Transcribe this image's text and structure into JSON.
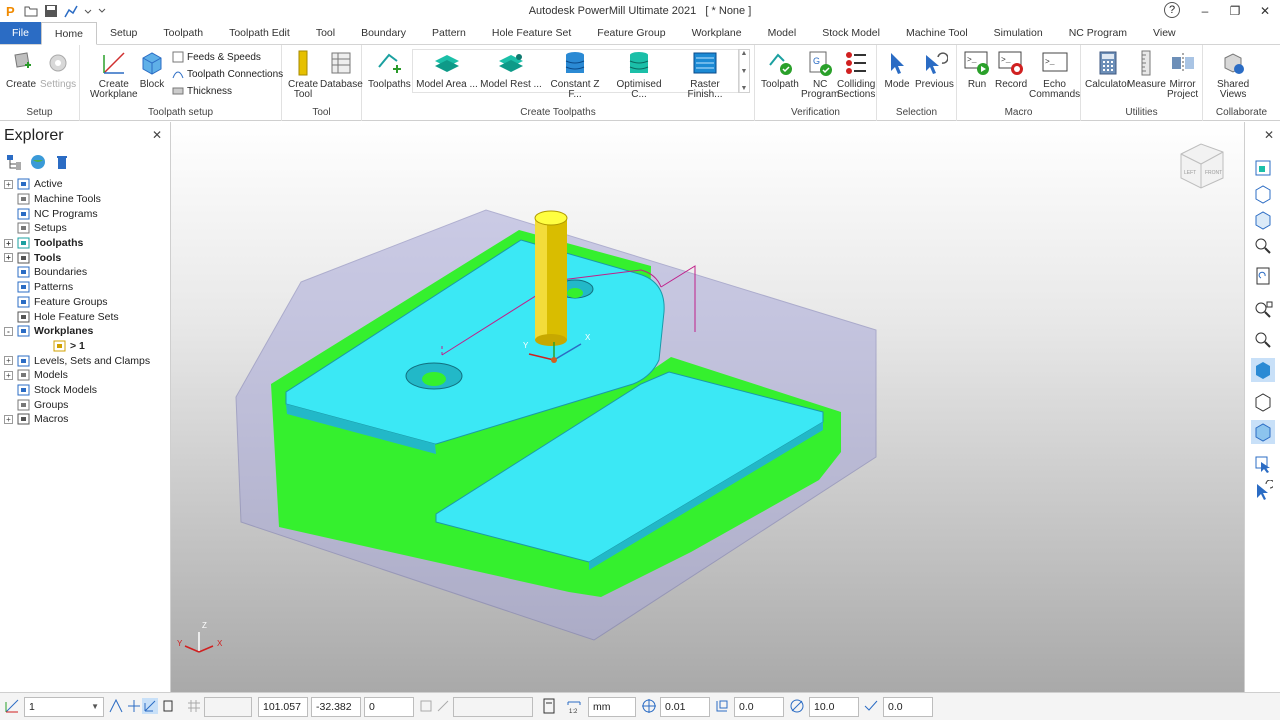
{
  "window": {
    "title": "Autodesk PowerMill Ultimate 2021",
    "document": "[  * None ]",
    "help": "?"
  },
  "tabs": [
    "File",
    "Home",
    "Setup",
    "Toolpath",
    "Toolpath Edit",
    "Tool",
    "Boundary",
    "Pattern",
    "Hole Feature Set",
    "Feature Group",
    "Workplane",
    "Model",
    "Stock Model",
    "Machine Tool",
    "Simulation",
    "NC Program",
    "View"
  ],
  "ribbon": {
    "setup": {
      "label": "Setup",
      "create": "Create",
      "settings": "Settings"
    },
    "toolpath_setup": {
      "label": "Toolpath setup",
      "create_workplane_1": "Create",
      "create_workplane_2": "Workplane",
      "block": "Block",
      "feeds": "Feeds & Speeds",
      "connections": "Toolpath Connections",
      "thickness": "Thickness"
    },
    "tool": {
      "label": "Tool",
      "create_tool_1": "Create",
      "create_tool_2": "Tool",
      "database": "Database"
    },
    "create_toolpaths": {
      "label": "Create Toolpaths",
      "toolpaths": "Toolpaths",
      "items": [
        "Model Area ...",
        "Model Rest ...",
        "Constant Z F...",
        "Optimised C...",
        "Raster Finish..."
      ]
    },
    "verification": {
      "label": "Verification",
      "toolpath": "Toolpath",
      "nc_1": "NC",
      "nc_2": "Program",
      "colliding_1": "Colliding",
      "colliding_2": "Sections"
    },
    "selection": {
      "label": "Selection",
      "mode": "Mode",
      "previous": "Previous"
    },
    "macro": {
      "label": "Macro",
      "run": "Run",
      "record": "Record",
      "echo_1": "Echo",
      "echo_2": "Commands"
    },
    "utilities": {
      "label": "Utilities",
      "calculator": "Calculator",
      "measure": "Measure",
      "mirror_1": "Mirror",
      "mirror_2": "Project"
    },
    "collaborate": {
      "label": "Collaborate",
      "shared_1": "Shared",
      "shared_2": "Views"
    }
  },
  "explorer": {
    "title": "Explorer",
    "items": [
      {
        "label": "Active",
        "expand": "+",
        "bold": false
      },
      {
        "label": "Machine Tools",
        "expand": "",
        "bold": false
      },
      {
        "label": "NC Programs",
        "expand": "",
        "bold": false
      },
      {
        "label": "Setups",
        "expand": "",
        "bold": false
      },
      {
        "label": "Toolpaths",
        "expand": "+",
        "bold": true
      },
      {
        "label": "Tools",
        "expand": "+",
        "bold": true
      },
      {
        "label": "Boundaries",
        "expand": "",
        "bold": false
      },
      {
        "label": "Patterns",
        "expand": "",
        "bold": false
      },
      {
        "label": "Feature Groups",
        "expand": "",
        "bold": false
      },
      {
        "label": "Hole Feature Sets",
        "expand": "",
        "bold": false
      },
      {
        "label": "Workplanes",
        "expand": "-",
        "bold": true
      },
      {
        "label": "> 1",
        "expand": "",
        "bold": true,
        "child": true
      },
      {
        "label": "Levels, Sets and Clamps",
        "expand": "+",
        "bold": false
      },
      {
        "label": "Models",
        "expand": "+",
        "bold": false
      },
      {
        "label": "Stock Models",
        "expand": "",
        "bold": false
      },
      {
        "label": "Groups",
        "expand": "",
        "bold": false
      },
      {
        "label": "Macros",
        "expand": "+",
        "bold": false
      }
    ]
  },
  "viewport": {
    "viewcube": "LEFT / FRONT",
    "triad": {
      "x": "X",
      "y": "Y",
      "z": "Z"
    },
    "tool_axis": {
      "x": "X",
      "y": "Y"
    }
  },
  "statusbar": {
    "workplane": "1",
    "x": "101.057",
    "y": "-32.382",
    "z": "0",
    "units": "mm",
    "tolerance": "0.01",
    "thickness": "0.0",
    "diameter": "10.0",
    "stepover": "0.0"
  },
  "colors": {
    "file_tab": "#2b6cc4",
    "part_cyan": "#3be8f5",
    "part_green": "#35f02e",
    "stock": "#9a9ad4",
    "tool": "#e0c400",
    "toolpath": "#c0208a"
  }
}
